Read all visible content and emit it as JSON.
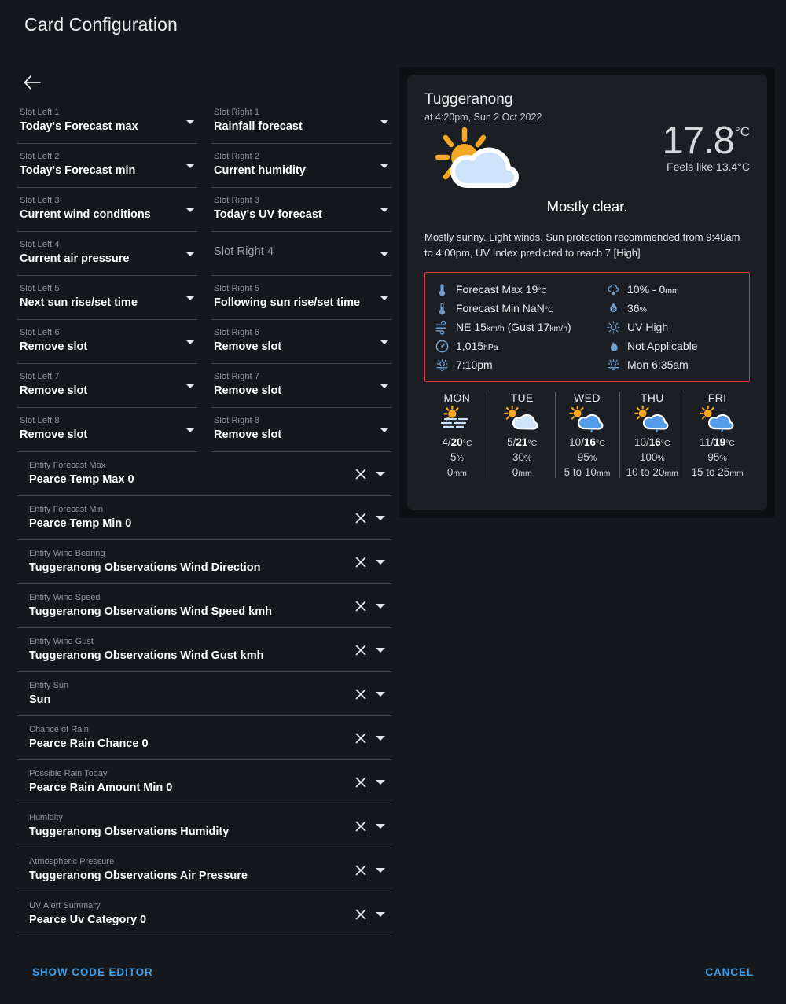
{
  "header": {
    "title": "Card Configuration"
  },
  "back_button": {
    "icon": "arrow-left-icon"
  },
  "slots": {
    "left": [
      {
        "label": "Slot Left 1",
        "value": "Today's Forecast max"
      },
      {
        "label": "Slot Left 2",
        "value": "Today's Forecast min"
      },
      {
        "label": "Slot Left 3",
        "value": "Current wind conditions"
      },
      {
        "label": "Slot Left 4",
        "value": "Current air pressure"
      },
      {
        "label": "Slot Left 5",
        "value": "Next sun rise/set time"
      },
      {
        "label": "Slot Left 6",
        "value": "Remove slot"
      },
      {
        "label": "Slot Left 7",
        "value": "Remove slot"
      },
      {
        "label": "Slot Left 8",
        "value": "Remove slot"
      }
    ],
    "right": [
      {
        "label": "Slot Right 1",
        "value": "Rainfall forecast"
      },
      {
        "label": "Slot Right 2",
        "value": "Current humidity"
      },
      {
        "label": "Slot Right 3",
        "value": "Today's UV forecast"
      },
      {
        "label": "Slot Right 4",
        "value": ""
      },
      {
        "label": "Slot Right 5",
        "value": "Following sun rise/set time"
      },
      {
        "label": "Slot Right 6",
        "value": "Remove slot"
      },
      {
        "label": "Slot Right 7",
        "value": "Remove slot"
      },
      {
        "label": "Slot Right 8",
        "value": "Remove slot"
      }
    ]
  },
  "entities": [
    {
      "label": "Entity Forecast Max",
      "value": "Pearce Temp Max 0"
    },
    {
      "label": "Entity Forecast Min",
      "value": "Pearce Temp Min 0"
    },
    {
      "label": "Entity Wind Bearing",
      "value": "Tuggeranong Observations Wind Direction"
    },
    {
      "label": "Entity Wind Speed",
      "value": "Tuggeranong Observations Wind Speed kmh"
    },
    {
      "label": "Entity Wind Gust",
      "value": "Tuggeranong Observations Wind Gust kmh"
    },
    {
      "label": "Entity Sun",
      "value": "Sun"
    },
    {
      "label": "Chance of Rain",
      "value": "Pearce Rain Chance 0"
    },
    {
      "label": "Possible Rain Today",
      "value": "Pearce Rain Amount Min 0"
    },
    {
      "label": "Humidity",
      "value": "Tuggeranong Observations Humidity"
    },
    {
      "label": "Atmospheric Pressure",
      "value": "Tuggeranong Observations Air Pressure"
    },
    {
      "label": "UV Alert Summary",
      "value": "Pearce Uv Category 0"
    }
  ],
  "footer": {
    "show_code_editor": "SHOW CODE EDITOR",
    "cancel": "CANCEL",
    "accent_color": "#3aa0f0"
  },
  "preview": {
    "location": "Tuggeranong",
    "observed_at": "at 4:20pm, Sun 2 Oct 2022",
    "current_icon": "sun-behind-cloud-icon",
    "temperature": "17.8",
    "temperature_unit": "°C",
    "feels_like": "Feels like 13.4°C",
    "summary": "Mostly clear.",
    "description": "Mostly sunny. Light winds. Sun protection recommended from 9:40am to 4:00pm, UV Index predicted to reach 7 [High]",
    "slot_border_color": "#e03c3c",
    "slot_rows": [
      {
        "icon": "thermometer-high-icon",
        "text": "Forecast Max 19",
        "unit": "°C"
      },
      {
        "icon": "rain-cloud-icon",
        "text": "10% - 0",
        "unit": "mm"
      },
      {
        "icon": "thermometer-low-icon",
        "text": "Forecast Min NaN",
        "unit": "°C"
      },
      {
        "icon": "humidity-icon",
        "text": "36",
        "unit": "%"
      },
      {
        "icon": "wind-icon",
        "text": "NE 15",
        "unit": "km/h",
        "text2": " (Gust 17",
        "unit2": "km/h",
        "text3": ")"
      },
      {
        "icon": "uv-index-icon",
        "text": "UV High",
        "unit": ""
      },
      {
        "icon": "gauge-icon",
        "text": "1,015",
        "unit": "hPa"
      },
      {
        "icon": "fire-danger-icon",
        "text": "Not Applicable",
        "unit": ""
      },
      {
        "icon": "sunset-icon",
        "text": "7:10pm",
        "unit": ""
      },
      {
        "icon": "sunrise-icon",
        "text": "Mon 6:35am",
        "unit": ""
      }
    ],
    "forecast": [
      {
        "dow": "MON",
        "icon": "sun-haze-icon",
        "min": "4",
        "max": "20",
        "temp_unit": "°C",
        "pop": "5",
        "pop_unit": "%",
        "amount": "0",
        "amount_unit": "mm"
      },
      {
        "dow": "TUE",
        "icon": "sun-cloud-icon",
        "min": "5",
        "max": "21",
        "temp_unit": "°C",
        "pop": "30",
        "pop_unit": "%",
        "amount": "0",
        "amount_unit": "mm"
      },
      {
        "dow": "WED",
        "icon": "sun-cloud-rain-icon",
        "min": "10",
        "max": "16",
        "temp_unit": "°C",
        "pop": "95",
        "pop_unit": "%",
        "amount": "5 to 10",
        "amount_unit": "mm"
      },
      {
        "dow": "THU",
        "icon": "sun-cloud-rain-icon",
        "min": "10",
        "max": "16",
        "temp_unit": "°C",
        "pop": "100",
        "pop_unit": "%",
        "amount": "10 to 20",
        "amount_unit": "mm"
      },
      {
        "dow": "FRI",
        "icon": "sun-cloud-rain-icon",
        "min": "11",
        "max": "19",
        "temp_unit": "°C",
        "pop": "95",
        "pop_unit": "%",
        "amount": "15 to 25",
        "amount_unit": "mm"
      }
    ]
  }
}
